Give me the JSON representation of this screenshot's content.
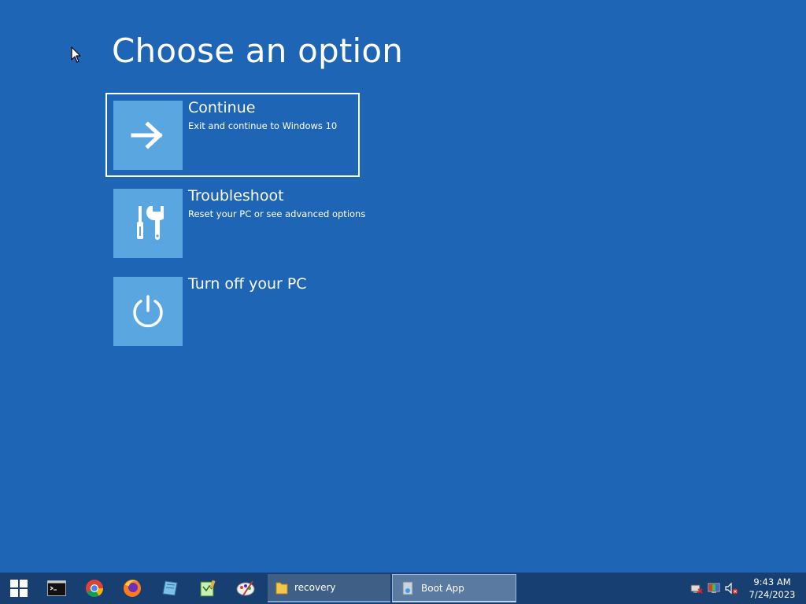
{
  "page_title": "Choose an option",
  "options": [
    {
      "title": "Continue",
      "description": "Exit and continue to Windows 10",
      "icon": "arrow-right-icon",
      "selected": true
    },
    {
      "title": "Troubleshoot",
      "description": "Reset your PC or see advanced options",
      "icon": "tools-icon",
      "selected": false
    },
    {
      "title": "Turn off your PC",
      "description": "",
      "icon": "power-icon",
      "selected": false
    }
  ],
  "taskbar": {
    "pinned": [
      "windows-start-icon",
      "command-prompt-icon",
      "chrome-icon",
      "firefox-icon",
      "notebook-icon",
      "notepad-icon",
      "paint-icon"
    ],
    "tasks": [
      {
        "label": "recovery",
        "icon": "folder-icon",
        "active": false
      },
      {
        "label": "Boot App",
        "icon": "boot-app-icon",
        "active": true
      }
    ],
    "tray": [
      "network-icon",
      "color-display-icon",
      "volume-muted-icon"
    ],
    "clock": {
      "time": "9:43 AM",
      "date": "7/24/2023"
    }
  },
  "colors": {
    "background": "#1f65b5",
    "tile": "#5aa6e0",
    "taskbar": "#173f72"
  }
}
